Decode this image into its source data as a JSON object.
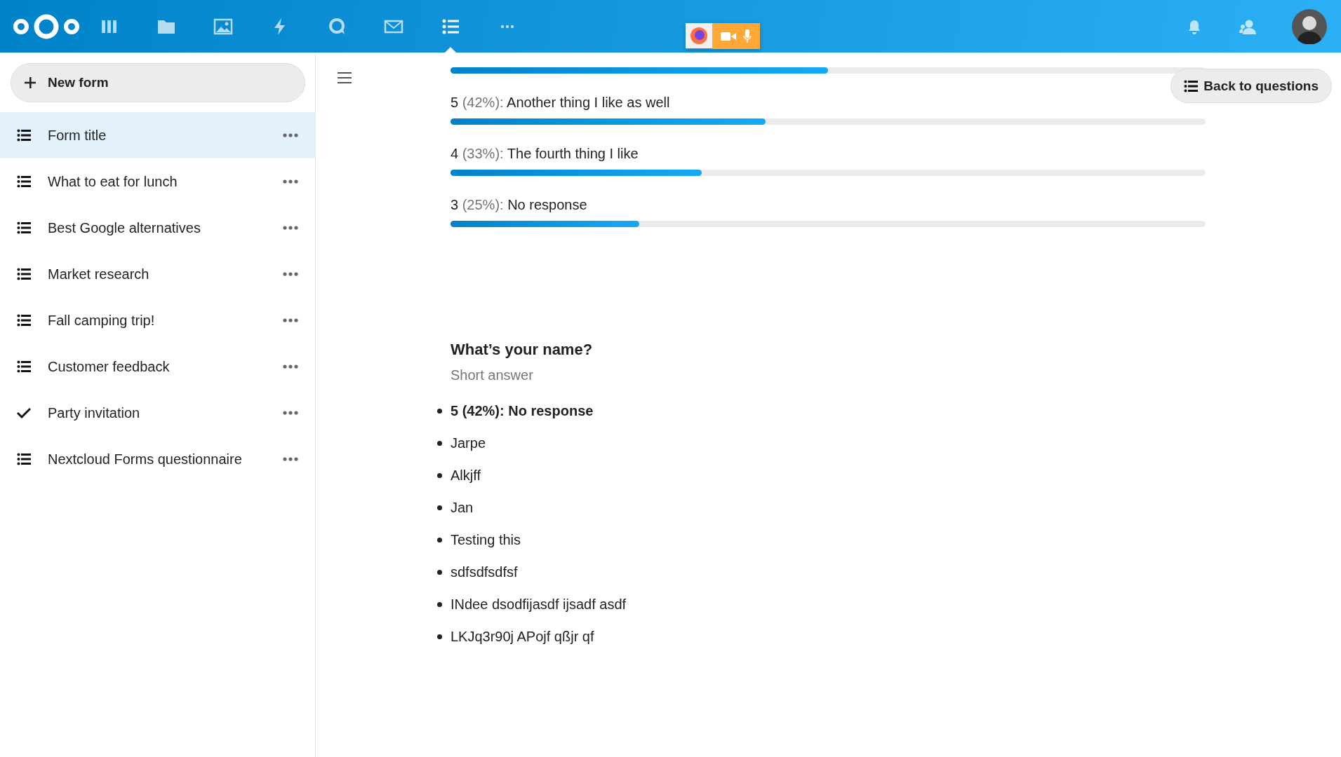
{
  "header": {
    "apps": [
      {
        "selected": false
      },
      {
        "selected": false
      },
      {
        "selected": false
      },
      {
        "selected": false
      },
      {
        "selected": false
      },
      {
        "selected": false
      },
      {
        "selected": true
      },
      {
        "selected": false
      }
    ]
  },
  "sidebar": {
    "new_button": "New form",
    "items": [
      {
        "title": "Form title",
        "selected": true,
        "expired": false
      },
      {
        "title": "What to eat for lunch",
        "selected": false,
        "expired": false
      },
      {
        "title": "Best Google alternatives",
        "selected": false,
        "expired": false
      },
      {
        "title": "Market research",
        "selected": false,
        "expired": false
      },
      {
        "title": "Fall camping trip!",
        "selected": false,
        "expired": false
      },
      {
        "title": "Customer feedback",
        "selected": false,
        "expired": false
      },
      {
        "title": "Party invitation",
        "selected": false,
        "expired": true
      },
      {
        "title": "Nextcloud Forms questionnaire",
        "selected": false,
        "expired": false
      }
    ]
  },
  "back_button": "Back to questions",
  "options": [
    {
      "level": 0.5
    },
    {
      "count": "5",
      "percent": "(42%):",
      "label": "Another thing I like as well",
      "level": 0.417
    },
    {
      "count": "4",
      "percent": "(33%):",
      "label": "The fourth thing I like",
      "level": 0.333
    },
    {
      "count": "3",
      "percent": "(25%):",
      "label": "No response",
      "level": 0.25
    }
  ],
  "question": {
    "title": "What’s your name?",
    "type": "Short answer",
    "answers": [
      {
        "text": "5 (42%): No response",
        "kind": "summary"
      },
      {
        "text": "Jarpe",
        "kind": "answer"
      },
      {
        "text": "Alkjff",
        "kind": "answer"
      },
      {
        "text": "Jan",
        "kind": "answer"
      },
      {
        "text": "Testing this",
        "kind": "answer"
      },
      {
        "text": "sdfsdfsdfsf",
        "kind": "answer"
      },
      {
        "text": "INdee dsodfijasdf ijsadf asdf",
        "kind": "answer"
      },
      {
        "text": "LKJq3r90j APojf qßjr qf",
        "kind": "answer"
      }
    ]
  }
}
